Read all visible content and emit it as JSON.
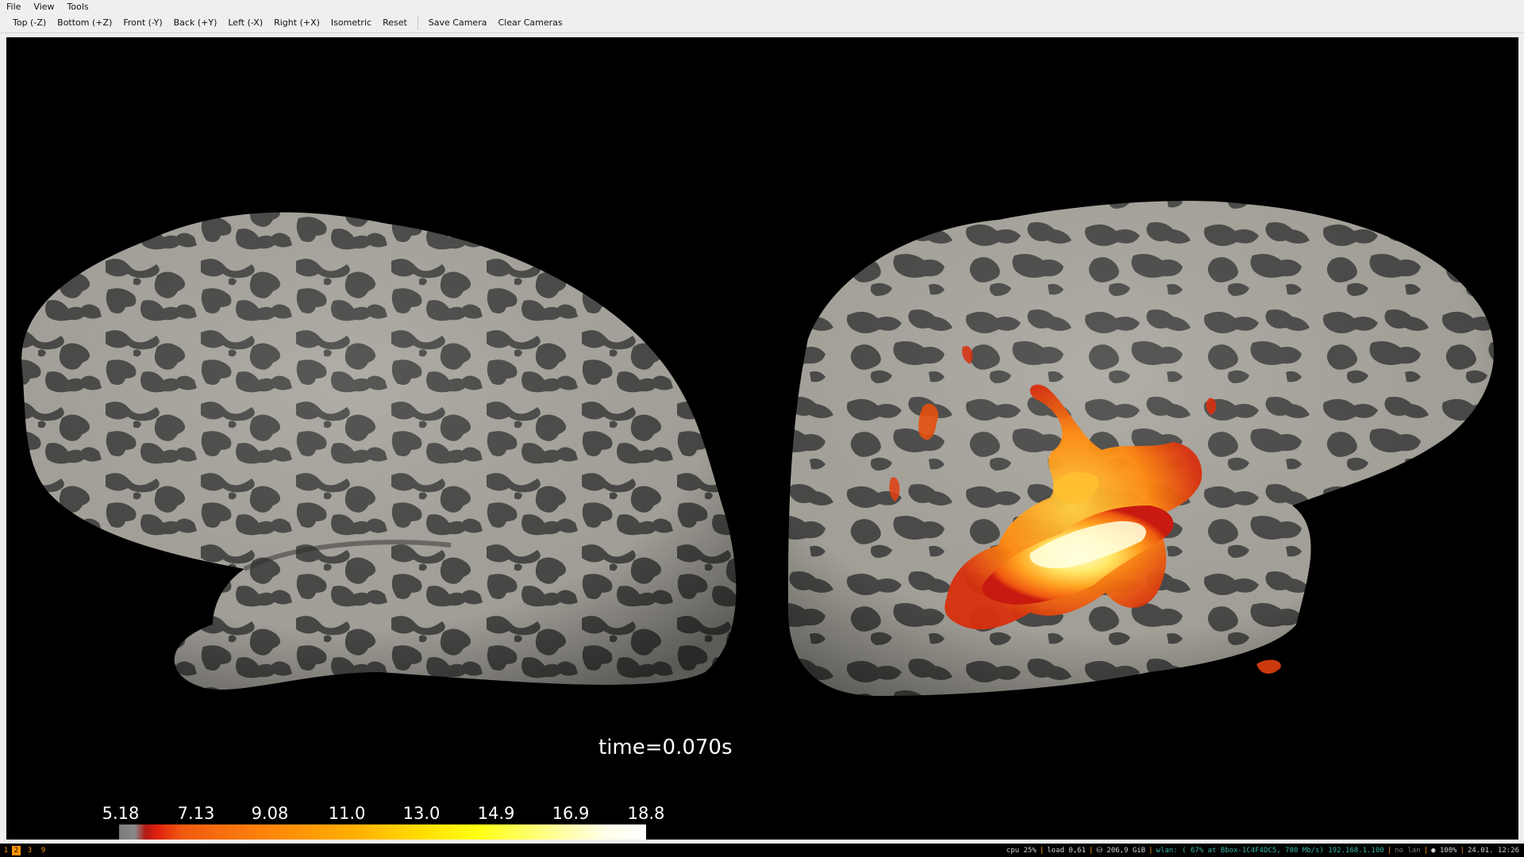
{
  "menubar": {
    "items": [
      "File",
      "View",
      "Tools"
    ]
  },
  "toolbar": {
    "buttons": [
      "Top (-Z)",
      "Bottom (+Z)",
      "Front (-Y)",
      "Back (+Y)",
      "Left (-X)",
      "Right (+X)",
      "Isometric",
      "Reset"
    ],
    "camera_buttons": [
      "Save Camera",
      "Clear Cameras"
    ]
  },
  "viewport": {
    "time_label": "time=0.070s",
    "colorbar_ticks": [
      "5.18",
      "7.13",
      "9.08",
      "11.0",
      "13.0",
      "14.9",
      "16.9",
      "18.8"
    ],
    "colors": {
      "background": "#000000",
      "sulci": "#4a4a48",
      "gyri": "#a8a59e"
    }
  },
  "statusbar": {
    "workspaces": [
      "1",
      "2",
      "3",
      "9"
    ],
    "active_workspace": "2",
    "cpu": "cpu  25%",
    "load": "load 0,61",
    "disk": "⛁ 206,9 GiB",
    "wlan": "wlan: ( 67% at Bbox-1C4F4DC5, 780 Mb/s) 192.168.1.100",
    "lan": "no lan",
    "battery": "● 100%",
    "datetime": "24.01. 12:26"
  }
}
